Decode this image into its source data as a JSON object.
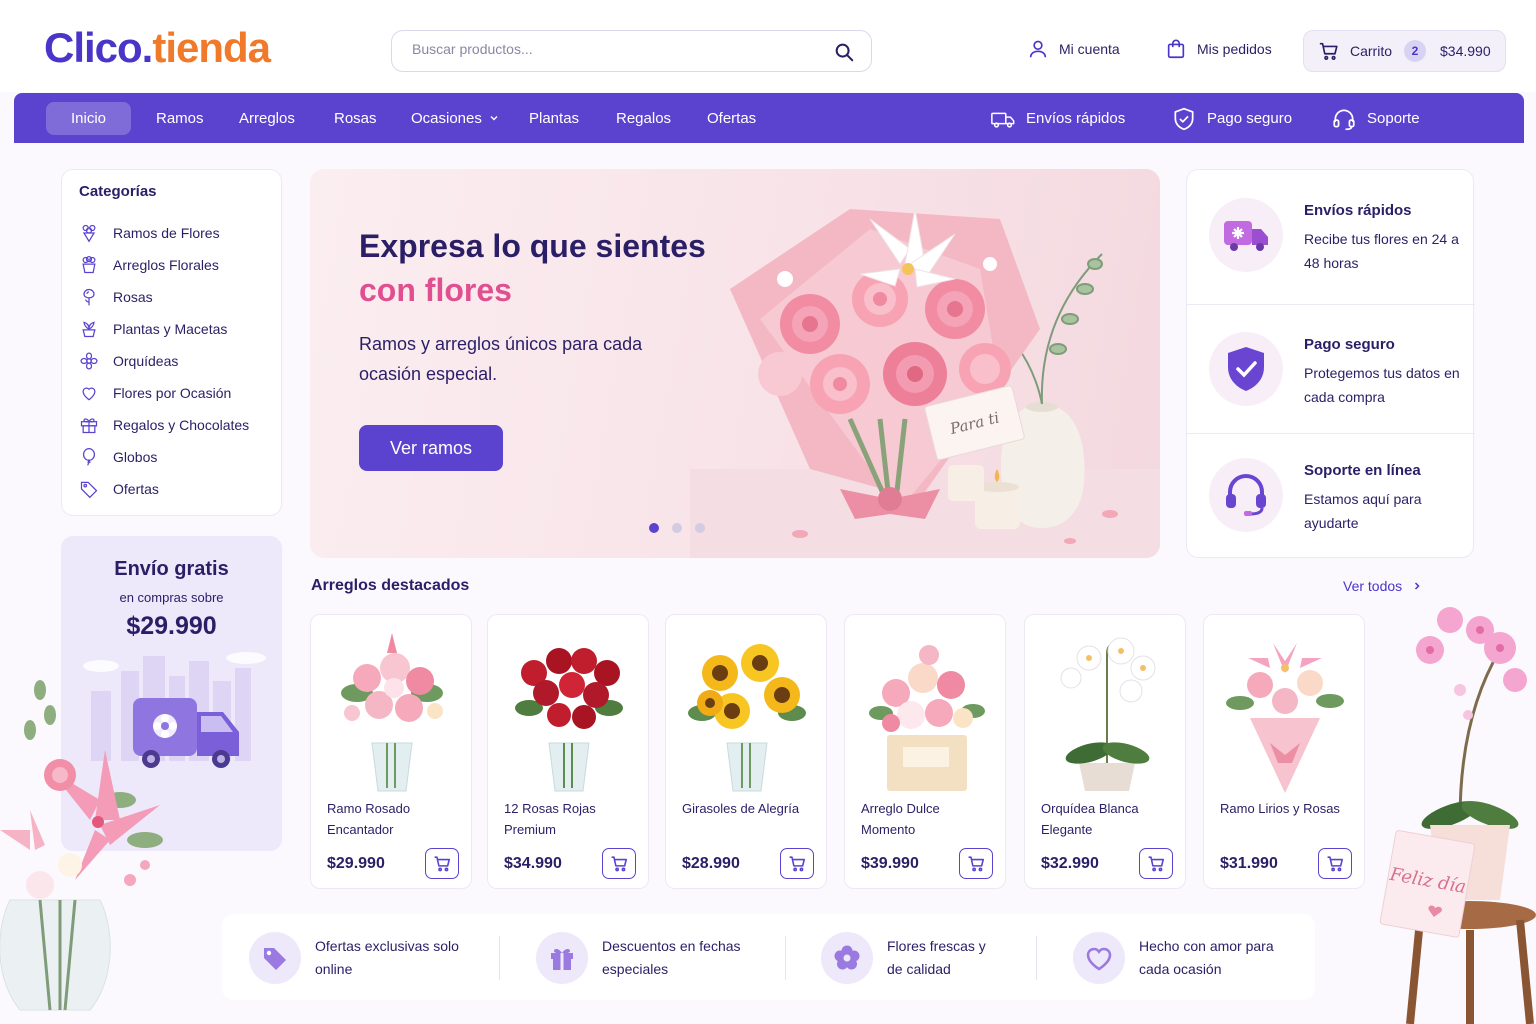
{
  "brand": {
    "part1": "Clico.",
    "part2": "tienda"
  },
  "header": {
    "search_placeholder": "Buscar productos...",
    "account": "Mi cuenta",
    "orders": "Mis pedidos",
    "cart_label": "Carrito",
    "cart_count": "2",
    "cart_total": "$34.990"
  },
  "nav": {
    "items": [
      "Inicio",
      "Ramos",
      "Arreglos",
      "Rosas",
      "Ocasiones",
      "Plantas",
      "Regalos",
      "Ofertas"
    ],
    "active": "Inicio",
    "right": [
      "Envíos rápidos",
      "Pago seguro",
      "Soporte"
    ]
  },
  "sidebar": {
    "title": "Categorías",
    "items": [
      "Ramos de Flores",
      "Arreglos Florales",
      "Rosas",
      "Plantas y Macetas",
      "Orquídeas",
      "Flores por Ocasión",
      "Regalos y Chocolates",
      "Globos",
      "Ofertas"
    ],
    "promo": {
      "title": "Envío gratis",
      "subtitle": "en compras sobre",
      "amount": "$29.990"
    }
  },
  "hero": {
    "title": "Expresa lo que sientes",
    "title_accent": "con flores",
    "subtitle": "Ramos y arreglos únicos para cada ocasión especial.",
    "cta": "Ver ramos",
    "card_text": "Para ti",
    "slides": 3,
    "active_slide": 1
  },
  "features": [
    {
      "title": "Envíos rápidos",
      "desc": "Recibe tus flores en 24 a 48 horas",
      "icon": "truck-icon"
    },
    {
      "title": "Pago seguro",
      "desc": "Protegemos tus datos en cada compra",
      "icon": "shield-icon"
    },
    {
      "title": "Soporte en línea",
      "desc": "Estamos aquí para ayudarte",
      "icon": "headset-icon"
    }
  ],
  "featured": {
    "title": "Arreglos destacados",
    "see_all": "Ver todos",
    "products": [
      {
        "name": "Ramo Rosado Encantador",
        "price": "$29.990"
      },
      {
        "name": "12 Rosas Rojas Premium",
        "price": "$34.990"
      },
      {
        "name": "Girasoles de Alegría",
        "price": "$28.990"
      },
      {
        "name": "Arreglo Dulce Momento",
        "price": "$39.990"
      },
      {
        "name": "Orquídea Blanca Elegante",
        "price": "$32.990"
      },
      {
        "name": "Ramo Lirios y Rosas",
        "price": "$31.990"
      }
    ]
  },
  "benefits": [
    {
      "text": "Ofertas exclusivas solo online",
      "icon": "tag-icon"
    },
    {
      "text": "Descuentos en fechas especiales",
      "icon": "gift-icon"
    },
    {
      "text": "Flores frescas y de calidad",
      "icon": "flower-icon"
    },
    {
      "text": "Hecho con amor para cada ocasión",
      "icon": "heart-icon"
    }
  ],
  "decor": {
    "card_text": "Feliz día"
  },
  "colors": {
    "primary": "#5b43cf",
    "accent": "#f07a2a",
    "pink": "#e04f8f",
    "text": "#2a1f66"
  }
}
